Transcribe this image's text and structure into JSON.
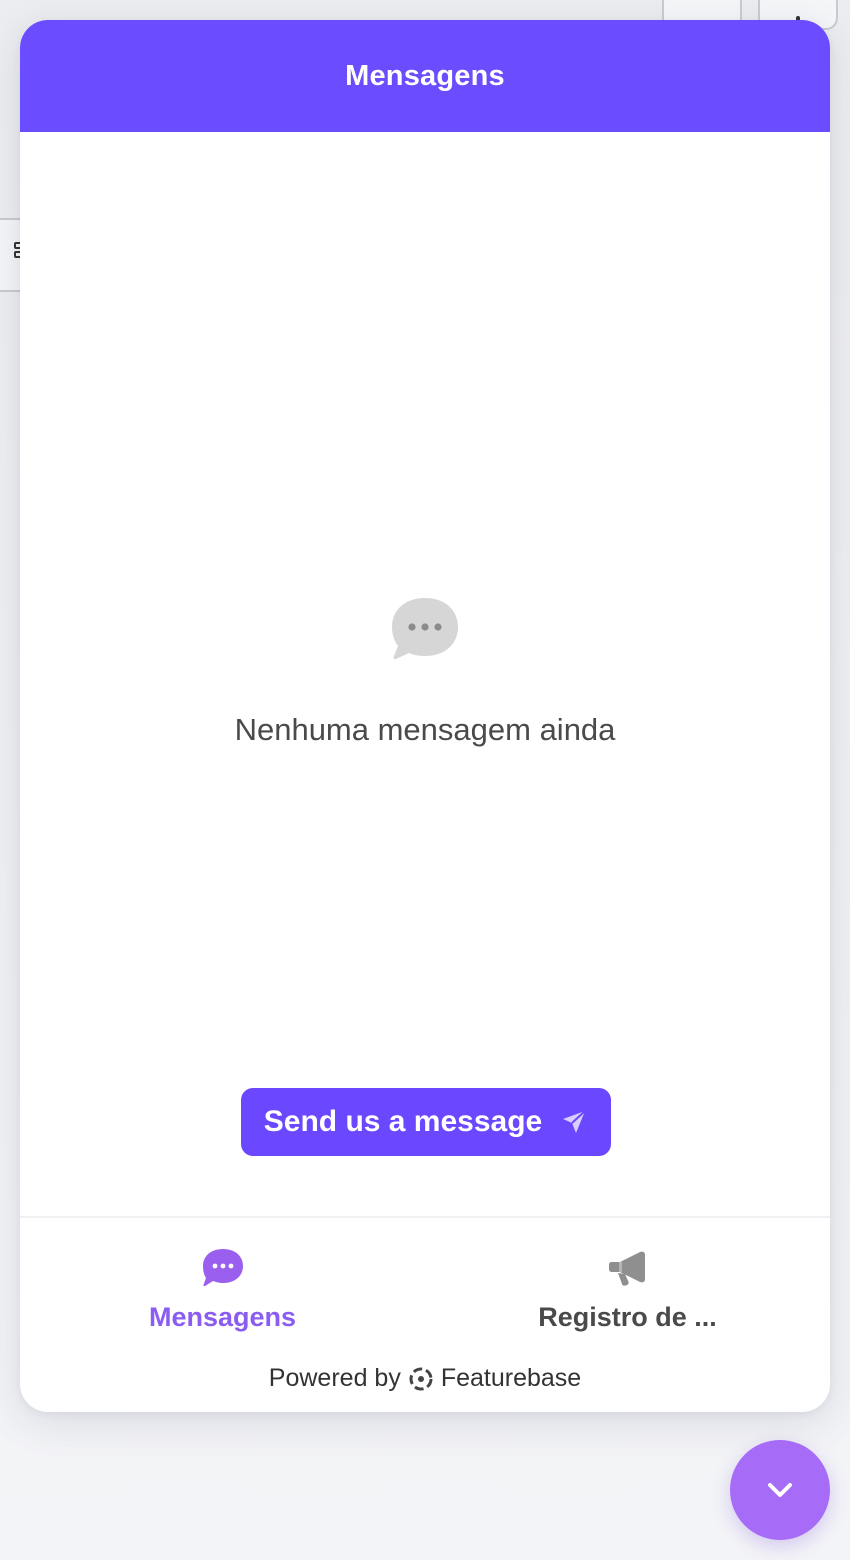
{
  "header": {
    "title": "Mensagens"
  },
  "empty_state": {
    "icon": "chat-bubble-ellipsis-icon",
    "text": "Nenhuma mensagem ainda"
  },
  "send_button": {
    "label": "Send us a message",
    "icon": "paper-plane-icon"
  },
  "nav": {
    "tabs": [
      {
        "label": "Mensagens",
        "icon": "chat-bubble-icon",
        "active": true
      },
      {
        "label": "Registro de ...",
        "icon": "megaphone-icon",
        "active": false
      }
    ]
  },
  "footer": {
    "powered_prefix": "Powered by",
    "brand": "Featurebase",
    "brand_icon": "featurebase-logo-icon"
  },
  "launcher": {
    "icon": "chevron-down-icon"
  },
  "colors": {
    "header_bg": "#6b4dff",
    "button_bg": "#6b47ff",
    "active_tab": "#8a5cf0",
    "launcher_bg": "#a66bf7",
    "empty_icon": "#d6d6d6"
  }
}
